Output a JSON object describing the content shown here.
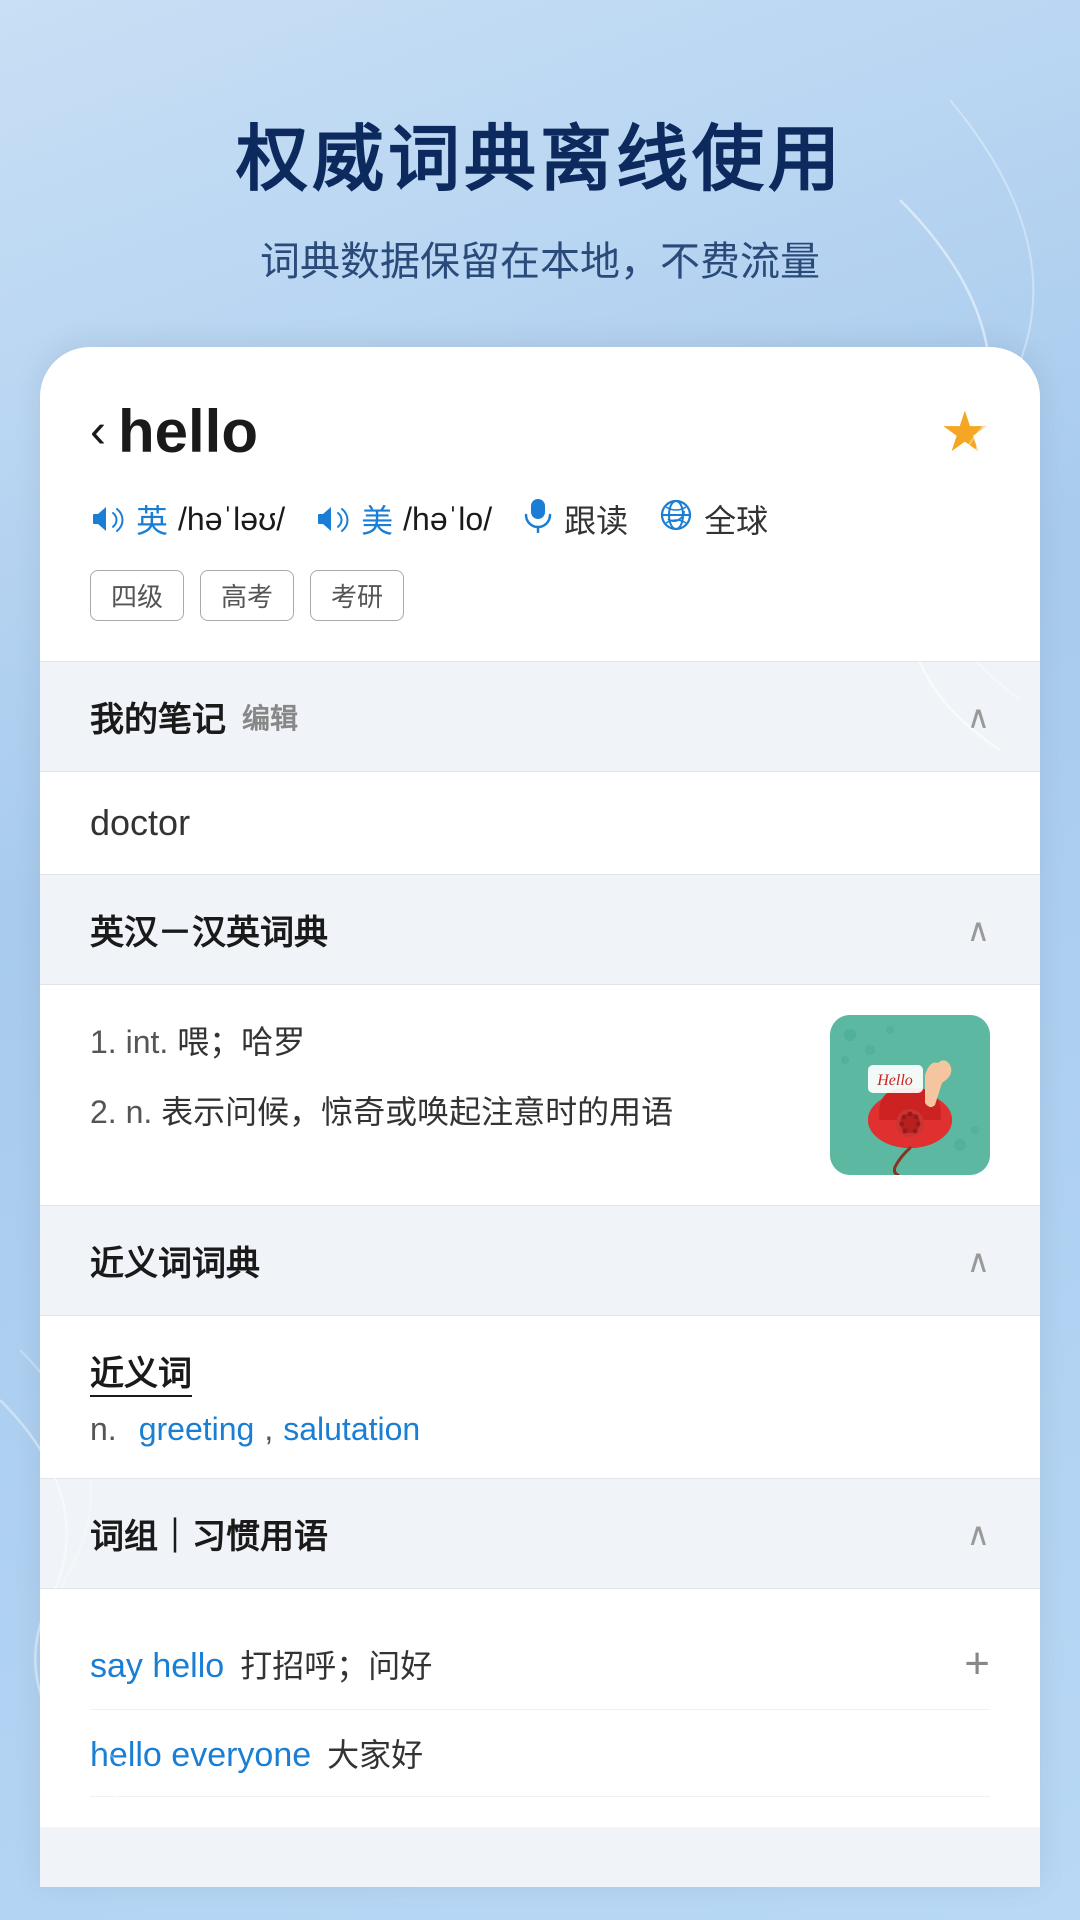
{
  "page": {
    "background_title": "权威词典离线使用",
    "background_subtitle": "词典数据保留在本地，不费流量"
  },
  "word_card": {
    "back_chevron": "‹",
    "word": "hello",
    "star_filled": "★",
    "pronunciations": [
      {
        "region": "英",
        "ipa": "/həˈləʊ/",
        "label": "英"
      },
      {
        "region": "美",
        "ipa": "/həˈlo/",
        "label": "美"
      }
    ],
    "follow_read_label": "跟读",
    "global_label": "全球",
    "tags": [
      "四级",
      "高考",
      "考研"
    ]
  },
  "sections": {
    "notes": {
      "title": "我的笔记",
      "edit_label": "编辑",
      "content": "doctor"
    },
    "dictionary": {
      "title": "英汉－汉英词典",
      "definitions": [
        {
          "num": "1.",
          "pos": "int.",
          "text": "喂；哈罗"
        },
        {
          "num": "2.",
          "pos": "n.",
          "text": "表示问候，惊奇或唤起注意时的用语"
        }
      ]
    },
    "synonyms": {
      "title": "近义词词典",
      "label": "近义词",
      "pos": "n.",
      "words": [
        "greeting",
        "salutation"
      ]
    },
    "phrases": {
      "title": "词组｜习惯用语",
      "items": [
        {
          "phrase": "say hello",
          "meaning": "打招呼；问好"
        },
        {
          "phrase": "hello everyone",
          "meaning": "大家好"
        }
      ]
    }
  },
  "colors": {
    "blue_accent": "#1a7fd4",
    "title_dark": "#0d2a5e",
    "star_yellow": "#f5a623"
  }
}
